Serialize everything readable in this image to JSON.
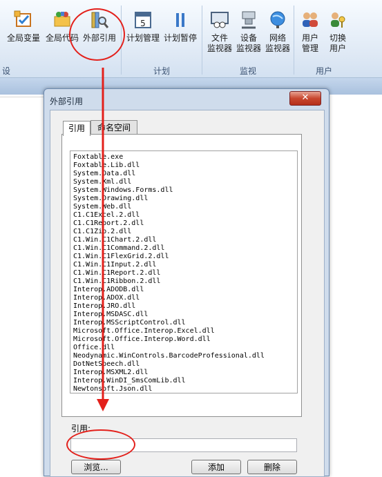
{
  "ribbon": {
    "buttons": [
      {
        "label": "全局变量",
        "icon": "global-variable-icon"
      },
      {
        "label": "全局代码",
        "icon": "global-code-icon"
      },
      {
        "label": "外部引用",
        "icon": "external-reference-icon"
      },
      {
        "label": "计划管理",
        "icon": "calendar-icon"
      },
      {
        "label": "计划暂停",
        "icon": "pause-icon"
      },
      {
        "label1": "文件",
        "label2": "监视器",
        "icon": "file-monitor-icon"
      },
      {
        "label1": "设备",
        "label2": "监视器",
        "icon": "device-monitor-icon"
      },
      {
        "label1": "网络",
        "label2": "监视器",
        "icon": "network-globe-icon"
      },
      {
        "label1": "用户",
        "label2": "管理",
        "icon": "user-management-icon"
      },
      {
        "label1": "切换",
        "label2": "用户",
        "icon": "switch-user-icon"
      }
    ],
    "groups": {
      "design_partial": "设计",
      "plan": "计划",
      "monitor": "监视",
      "user": "用户"
    }
  },
  "dialog": {
    "title": "外部引用",
    "close_glyph": "✕",
    "tabs": [
      "引用",
      "命名空间"
    ],
    "references": [
      "Foxtable.exe",
      "Foxtable.Lib.dll",
      "System.Data.dll",
      "System.Xml.dll",
      "System.Windows.Forms.dll",
      "System.Drawing.dll",
      "System.Web.dll",
      "C1.C1Excel.2.dll",
      "C1.C1Report.2.dll",
      "C1.C1Zip.2.dll",
      "C1.Win.C1Chart.2.dll",
      "C1.Win.C1Command.2.dll",
      "C1.Win.C1FlexGrid.2.dll",
      "C1.Win.C1Input.2.dll",
      "C1.Win.C1Report.2.dll",
      "C1.Win.C1Ribbon.2.dll",
      "Interop.ADODB.dll",
      "Interop.ADOX.dll",
      "Interop.JRO.dll",
      "Interop.MSDASC.dll",
      "Interop.MSScriptControl.dll",
      "Microsoft.Office.Interop.Excel.dll",
      "Microsoft.Office.Interop.Word.dll",
      "Office.dll",
      "Neodynamic.WinControls.BarcodeProfessional.dll",
      "DotNetSpeech.dll",
      "Interop.MSXML2.dll",
      "Interop.WinDI_SmsComLib.dll",
      "Newtonsoft.Json.dll"
    ],
    "reference_label": "引用:",
    "reference_value": "",
    "browse_button": "浏览...",
    "add_button": "添加",
    "delete_button": "删除",
    "scroll_up": "▲",
    "scroll_down": "▼"
  },
  "colors": {
    "annotation": "#e3201b",
    "ribbon_bg": "#dfe9f5",
    "dialog_frame": "#cfdcec"
  }
}
